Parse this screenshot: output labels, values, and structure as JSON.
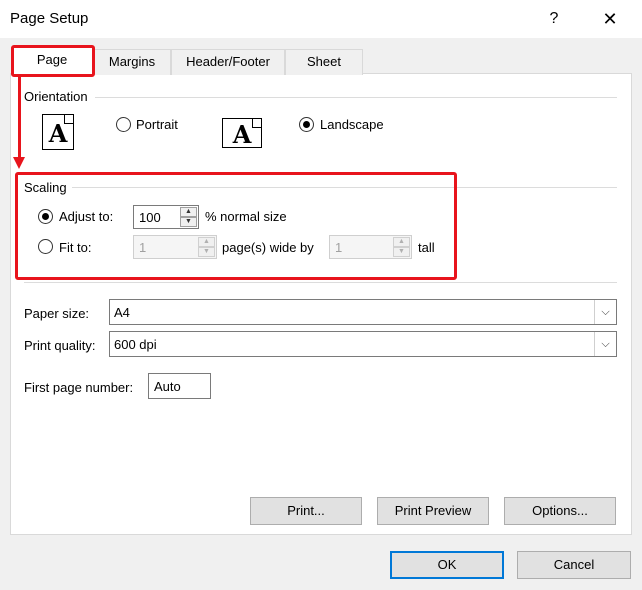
{
  "window": {
    "title": "Page Setup",
    "help_glyph": "?",
    "close_glyph": "✕"
  },
  "tabs": [
    {
      "label": "Page",
      "active": true
    },
    {
      "label": "Margins",
      "active": false
    },
    {
      "label": "Header/Footer",
      "active": false
    },
    {
      "label": "Sheet",
      "active": false
    }
  ],
  "orientation": {
    "label": "Orientation",
    "icon_letter": "A",
    "portrait_label": "Portrait",
    "landscape_label": "Landscape",
    "selected": "landscape"
  },
  "scaling": {
    "label": "Scaling",
    "adjust_label": "Adjust to:",
    "adjust_value": "100",
    "adjust_suffix": "% normal size",
    "fit_label": "Fit to:",
    "fit_wide_value": "1",
    "fit_wide_suffix": "page(s) wide by",
    "fit_tall_value": "1",
    "fit_tall_suffix": "tall",
    "selected": "adjust"
  },
  "paper_size": {
    "label": "Paper size:",
    "value": "A4"
  },
  "print_quality": {
    "label": "Print quality:",
    "value": "600 dpi"
  },
  "first_page": {
    "label": "First page number:",
    "value": "Auto"
  },
  "buttons": {
    "print": "Print...",
    "print_preview": "Print Preview",
    "options": "Options...",
    "ok": "OK",
    "cancel": "Cancel"
  },
  "icons": {
    "spin_up": "▲",
    "spin_down": "▼",
    "dropdown_arrow": "⌵"
  },
  "colors": {
    "annotation": "#e8141c",
    "focus": "#0078d7"
  }
}
